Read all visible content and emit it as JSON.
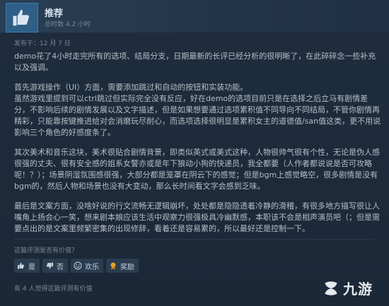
{
  "header": {
    "recommendation": "推荐",
    "hours_on_record": "总时数 4.2 小时"
  },
  "review": {
    "posted_date": "发布于：12 月 7 日",
    "paragraphs": [
      "demo花了4小时走完所有的选项、结局分支，日期最新的长评已经分析的很明晰了，在此碎碎念一些补充以及强调。",
      "首先游戏操作（UI）方面，需要添加跳过和自动的按钮和实装功能。\n虽然游戏里提到可以ctrl跳过但实际完全没有反应，好在demo的选项目前只是在选择之后立马有剧情差分，不影响后续的剧情发展以及文字描述，但是如果想要通过选项累积值不同导向不同结局，不管你剧情再精彩，只能靠按键推进给对会消磨玩尽耐心，而选项选择很明显是累积女主的道德值/san值这类，更不用说影响三个角色的好感度条了。",
      "其次美术和音乐这块，美术很贴合剧情背景，即类似英式或美式这种，人物很帅气很有个性，无论是伪人感很强的丈夫、很有安全感的姐系女警亦或是年下狼动小狗的快递员，我全都要（人作者都说说是否可攻略呢！？）；场景阴湿氛围感很强，大部分都是笼罩在阴云下的感觉；但是bgm上感觉略空，很多剧情是没有bgm的，然后人物和场景也没有大变动，那么长时间看文字会感到乏味。",
      "最后是文案方面，没啥好说的行文流畅无逻辑崩坏，处处都是隐隐透着冷静的滑稽，有很多地方描写很让人嘴角上扬会心一笑，想来剧本娘应该生活中观察力很强极具冷幽默感，本职该不会是相声演员吧（；但是需要点出的是文案里频繁密集的出现修辞，看着还是容易累的，所以最好还是控制一下。"
    ]
  },
  "feedback": {
    "question": "这篇评测是否有价值？",
    "yes": "是",
    "no": "否",
    "funny": "欢乐",
    "award": "奖励",
    "found_helpful": "有 4 人觉得这篇评测有价值"
  },
  "watermark": {
    "text": "九游"
  },
  "colors": {
    "background": "#1b2838",
    "thumb_box": "#2f5e86",
    "vote_button": "#2a3c50",
    "award_icon": "#e0a32a"
  }
}
